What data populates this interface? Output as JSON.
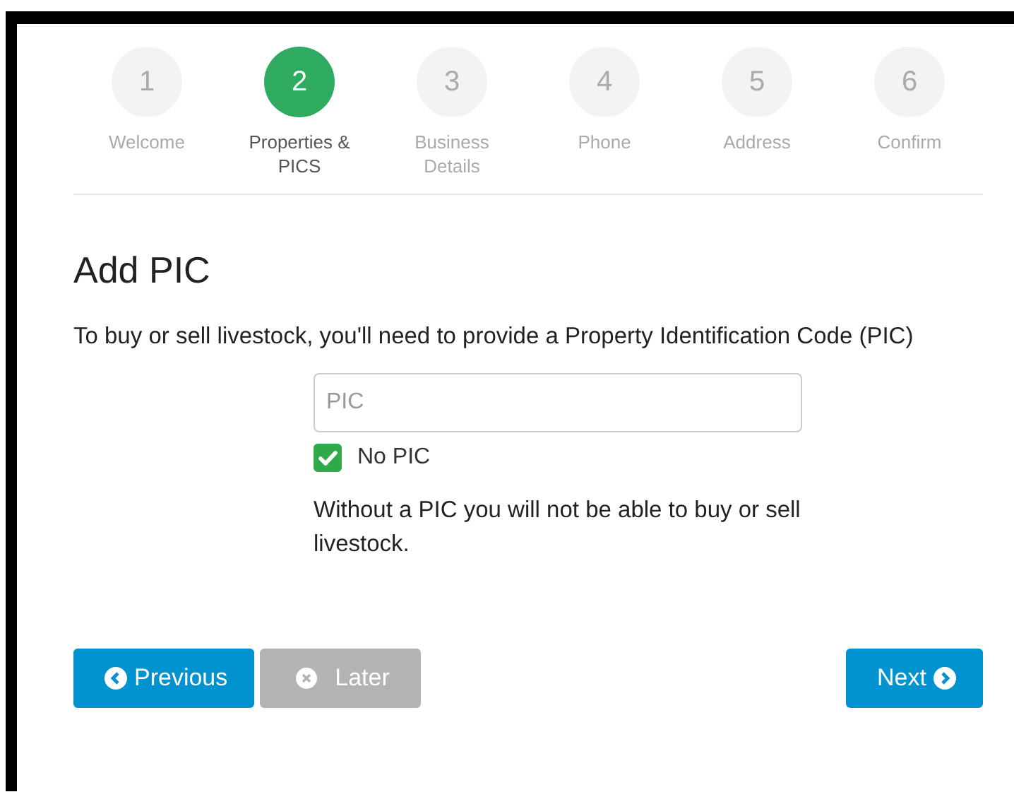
{
  "steps": [
    {
      "number": "1",
      "label": "Welcome",
      "selected": false
    },
    {
      "number": "2",
      "label": "Properties & PICS",
      "selected": true
    },
    {
      "number": "3",
      "label": "Business Details",
      "selected": false
    },
    {
      "number": "4",
      "label": "Phone",
      "selected": false
    },
    {
      "number": "5",
      "label": "Address",
      "selected": false
    },
    {
      "number": "6",
      "label": "Confirm",
      "selected": false
    }
  ],
  "heading": "Add PIC",
  "intro": "To buy or sell livestock, you'll need to provide a Property Identification Code (PIC)",
  "pic_field": {
    "placeholder": "PIC"
  },
  "no_pic": {
    "label": "No PIC",
    "checked": true
  },
  "note": "Without a PIC you will not be able to buy or sell livestock.",
  "buttons": [
    {
      "label": "Previous",
      "kind": "back",
      "disabled": false
    },
    {
      "label": "Later",
      "kind": "skip",
      "disabled": true
    },
    {
      "label": "Next",
      "kind": "forward",
      "disabled": false
    }
  ]
}
